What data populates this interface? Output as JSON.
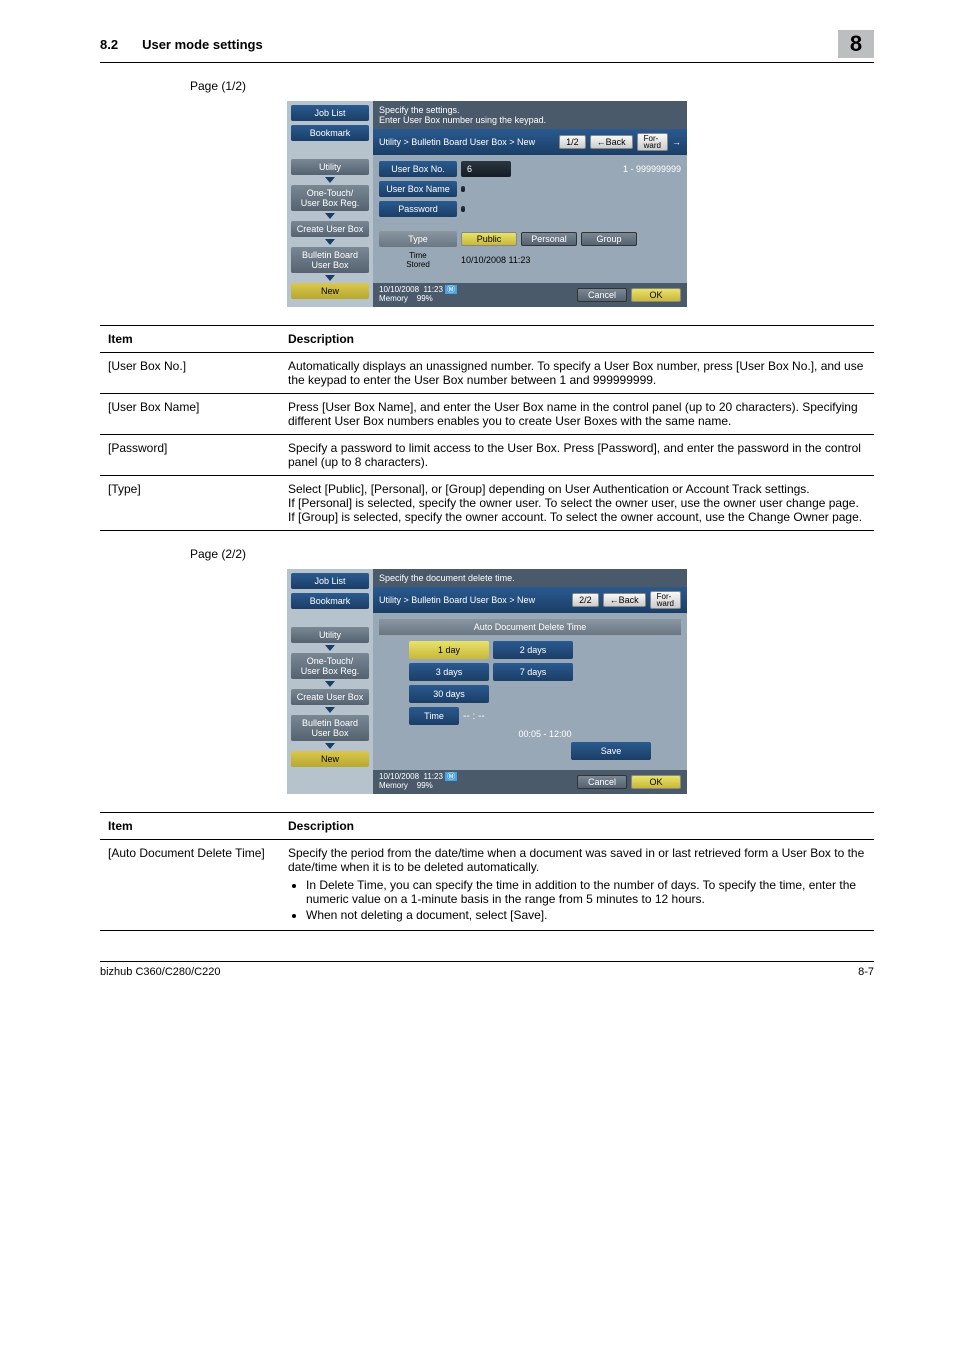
{
  "header": {
    "section_num": "8.2",
    "section_title": "User mode settings",
    "badge": "8"
  },
  "page1_label": "Page (1/2)",
  "page2_label": "Page (2/2)",
  "panel1": {
    "job_list": "Job List",
    "bookmark": "Bookmark",
    "utility": "Utility",
    "onetouch": "One-Touch/\nUser Box Reg.",
    "create": "Create User Box",
    "bulletin": "Bulletin Board\nUser Box",
    "new": "New",
    "top_text": "Specify the settings.\nEnter User Box number using the keypad.",
    "breadcrumb": "Utility > Bulletin Board User Box > New",
    "pagenum": "1/2",
    "back": "←Back",
    "forward": "For-\nward",
    "user_box_no_lab": "User Box No.",
    "user_box_no_val": "6",
    "range": "1 - 999999999",
    "user_box_name_lab": "User Box Name",
    "password_lab": "Password",
    "type_lab": "Type",
    "public": "Public",
    "personal": "Personal",
    "group": "Group",
    "time_stored_lab": "Time\nStored",
    "time_stored_val": "10/10/2008   11:23",
    "status_date": "10/10/2008",
    "status_time": "11:23",
    "status_mem": "Memory",
    "status_pct": "99%",
    "cancel": "Cancel",
    "ok": "OK"
  },
  "panel2": {
    "top_text": "Specify the document delete time.",
    "breadcrumb": "Utility > Bulletin Board User Box > New",
    "pagenum": "2/2",
    "sub_head": "Auto Document Delete Time",
    "d1": "1 day",
    "d2": "2 days",
    "d3": "3 days",
    "d7": "7 days",
    "d30": "30 days",
    "time_lab": "Time",
    "time_val": "-- : --",
    "time_range": "00:05  -  12:00",
    "save": "Save"
  },
  "table1": {
    "h1": "Item",
    "h2": "Description",
    "rows": [
      {
        "item": "[User Box No.]",
        "desc": "Automatically displays an unassigned number. To specify a User Box number, press [User Box No.], and use the keypad to enter the User Box number between 1 and 999999999."
      },
      {
        "item": "[User Box Name]",
        "desc": "Press [User Box Name], and enter the User Box name in the control panel (up to 20 characters). Specifying different User Box numbers enables you to create User Boxes with the same name."
      },
      {
        "item": "[Password]",
        "desc": "Specify a password to limit access to the User Box. Press [Password], and enter the password in the control panel (up to 8 characters)."
      },
      {
        "item": "[Type]",
        "desc": "Select [Public], [Personal], or [Group] depending on User Authentication or Account Track settings.\nIf [Personal] is selected, specify the owner user. To select the owner user, use the owner user change page.\nIf [Group] is selected, specify the owner account. To select the owner account, use the Change Owner page."
      }
    ]
  },
  "table2": {
    "h1": "Item",
    "h2": "Description",
    "item": "[Auto Document Delete Time]",
    "desc_intro": "Specify the period from the date/time when a document was saved in or last retrieved form a User Box to the date/time when it is to be deleted automatically.",
    "b1": "In Delete Time, you can specify the time in addition to the number of days. To specify the time, enter the numeric value on a 1-minute basis in the range from 5 minutes to 12 hours.",
    "b2": "When not deleting a document, select [Save]."
  },
  "footer": {
    "left": "bizhub C360/C280/C220",
    "right": "8-7"
  }
}
